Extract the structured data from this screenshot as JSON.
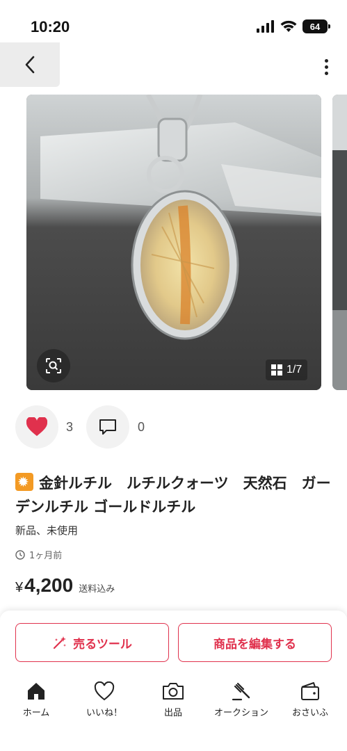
{
  "status_bar": {
    "time": "10:20",
    "battery": "64"
  },
  "carousel": {
    "counter": "1/7"
  },
  "reactions": {
    "likes": "3",
    "comments": "0"
  },
  "item": {
    "title": "金針ルチル　ルチルクォーツ　天然石　ガーデンルチル ゴールドルチル",
    "condition": "新品、未使用",
    "listed_ago": "1ヶ月前",
    "price_currency": "¥",
    "price": "4,200",
    "price_note": "送料込み"
  },
  "actions": {
    "sell_tool": "売るツール",
    "edit_item": "商品を編集する"
  },
  "tabs": [
    {
      "label": "ホーム",
      "icon": "home-icon"
    },
    {
      "label": "いいね！",
      "icon": "heart-icon"
    },
    {
      "label": "出品",
      "icon": "camera-icon"
    },
    {
      "label": "オークション",
      "icon": "gavel-icon"
    },
    {
      "label": "おさいふ",
      "icon": "wallet-icon"
    }
  ],
  "colors": {
    "accent": "#e0314d",
    "like": "#e0314d"
  }
}
